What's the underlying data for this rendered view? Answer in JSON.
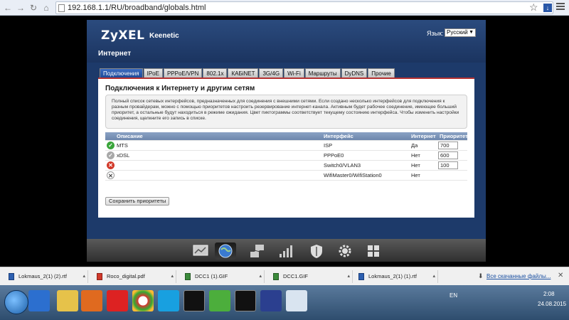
{
  "browser": {
    "url": "192.168.1.1/RU/broadband/globals.html",
    "back_icon": "back-arrow",
    "forward_icon": "forward-arrow",
    "reload_icon": "reload",
    "home_icon": "home"
  },
  "router": {
    "brand": "ZyXEL",
    "model": "Keenetic",
    "language_label": "Язык:",
    "language_value": "Русский",
    "section_title": "Интернет",
    "tabs": [
      "Подключения",
      "IPoE",
      "PPPoE/VPN",
      "802.1x",
      "КАБiNET",
      "3G/4G",
      "Wi-Fi",
      "Маршруты",
      "DyDNS",
      "Прочие"
    ],
    "active_tab": "Подключения",
    "panel_title": "Подключения к Интернету и другим сетям",
    "info_text": "Полный список сетевых интерфейсов, предназначенных для соединения с внешними сетями. Если создано несколько интерфейсов для подключения к разным провайдерам, можно с помощью приоритетов настроить резервирование интернет-канала. Активным будет рабочее соединение, имеющее больший приоритет, а остальные будут находиться в режиме ожидания. Цвет пиктограммы соответствует текущему состоянию интерфейса. Чтобы изменить настройки соединения, щелкните его запись в списке.",
    "table": {
      "headers": {
        "description": "Описание",
        "interface": "Интерфейс",
        "internet": "Интернет",
        "priority": "Приоритет"
      },
      "rows": [
        {
          "status": "ok",
          "description": "MTS",
          "interface": "ISP",
          "internet": "Да",
          "priority": "700"
        },
        {
          "status": "grey",
          "description": "xDSL",
          "interface": "PPPoE0",
          "internet": "Нет",
          "priority": "600"
        },
        {
          "status": "error",
          "description": "",
          "interface": "Switch0/VLAN3",
          "internet": "Нет",
          "priority": "100"
        },
        {
          "status": "off",
          "description": "",
          "interface": "WifiMaster0/WifiStation0",
          "internet": "Нет",
          "priority": ""
        }
      ]
    },
    "save_button": "Сохранить приоритеты",
    "dock_icons": [
      "monitor-icon",
      "globe-icon",
      "network-icon",
      "signal-icon",
      "shield-icon",
      "gear-icon",
      "grid-icon"
    ],
    "active_dock": "globe-icon"
  },
  "downloads": {
    "items": [
      {
        "name": "Lokmaus_2(1) (2).rtf",
        "type": "rtf"
      },
      {
        "name": "Roco_digital.pdf",
        "type": "pdf"
      },
      {
        "name": "DCC1 (1).GIF",
        "type": "gif"
      },
      {
        "name": "DCC1.GIF",
        "type": "gif"
      },
      {
        "name": "Lokmaus_2(1) (1).rtf",
        "type": "rtf"
      }
    ],
    "all_label": "Все скачанные файлы..."
  },
  "taskbar": {
    "apps": [
      "explorer",
      "ie",
      "media-player",
      "yandex",
      "chrome",
      "skype",
      "cmd",
      "utorrent",
      "cmd2",
      "floppy",
      "paint"
    ],
    "lang": "EN",
    "time": "2:08",
    "date": "24.08.2015"
  }
}
